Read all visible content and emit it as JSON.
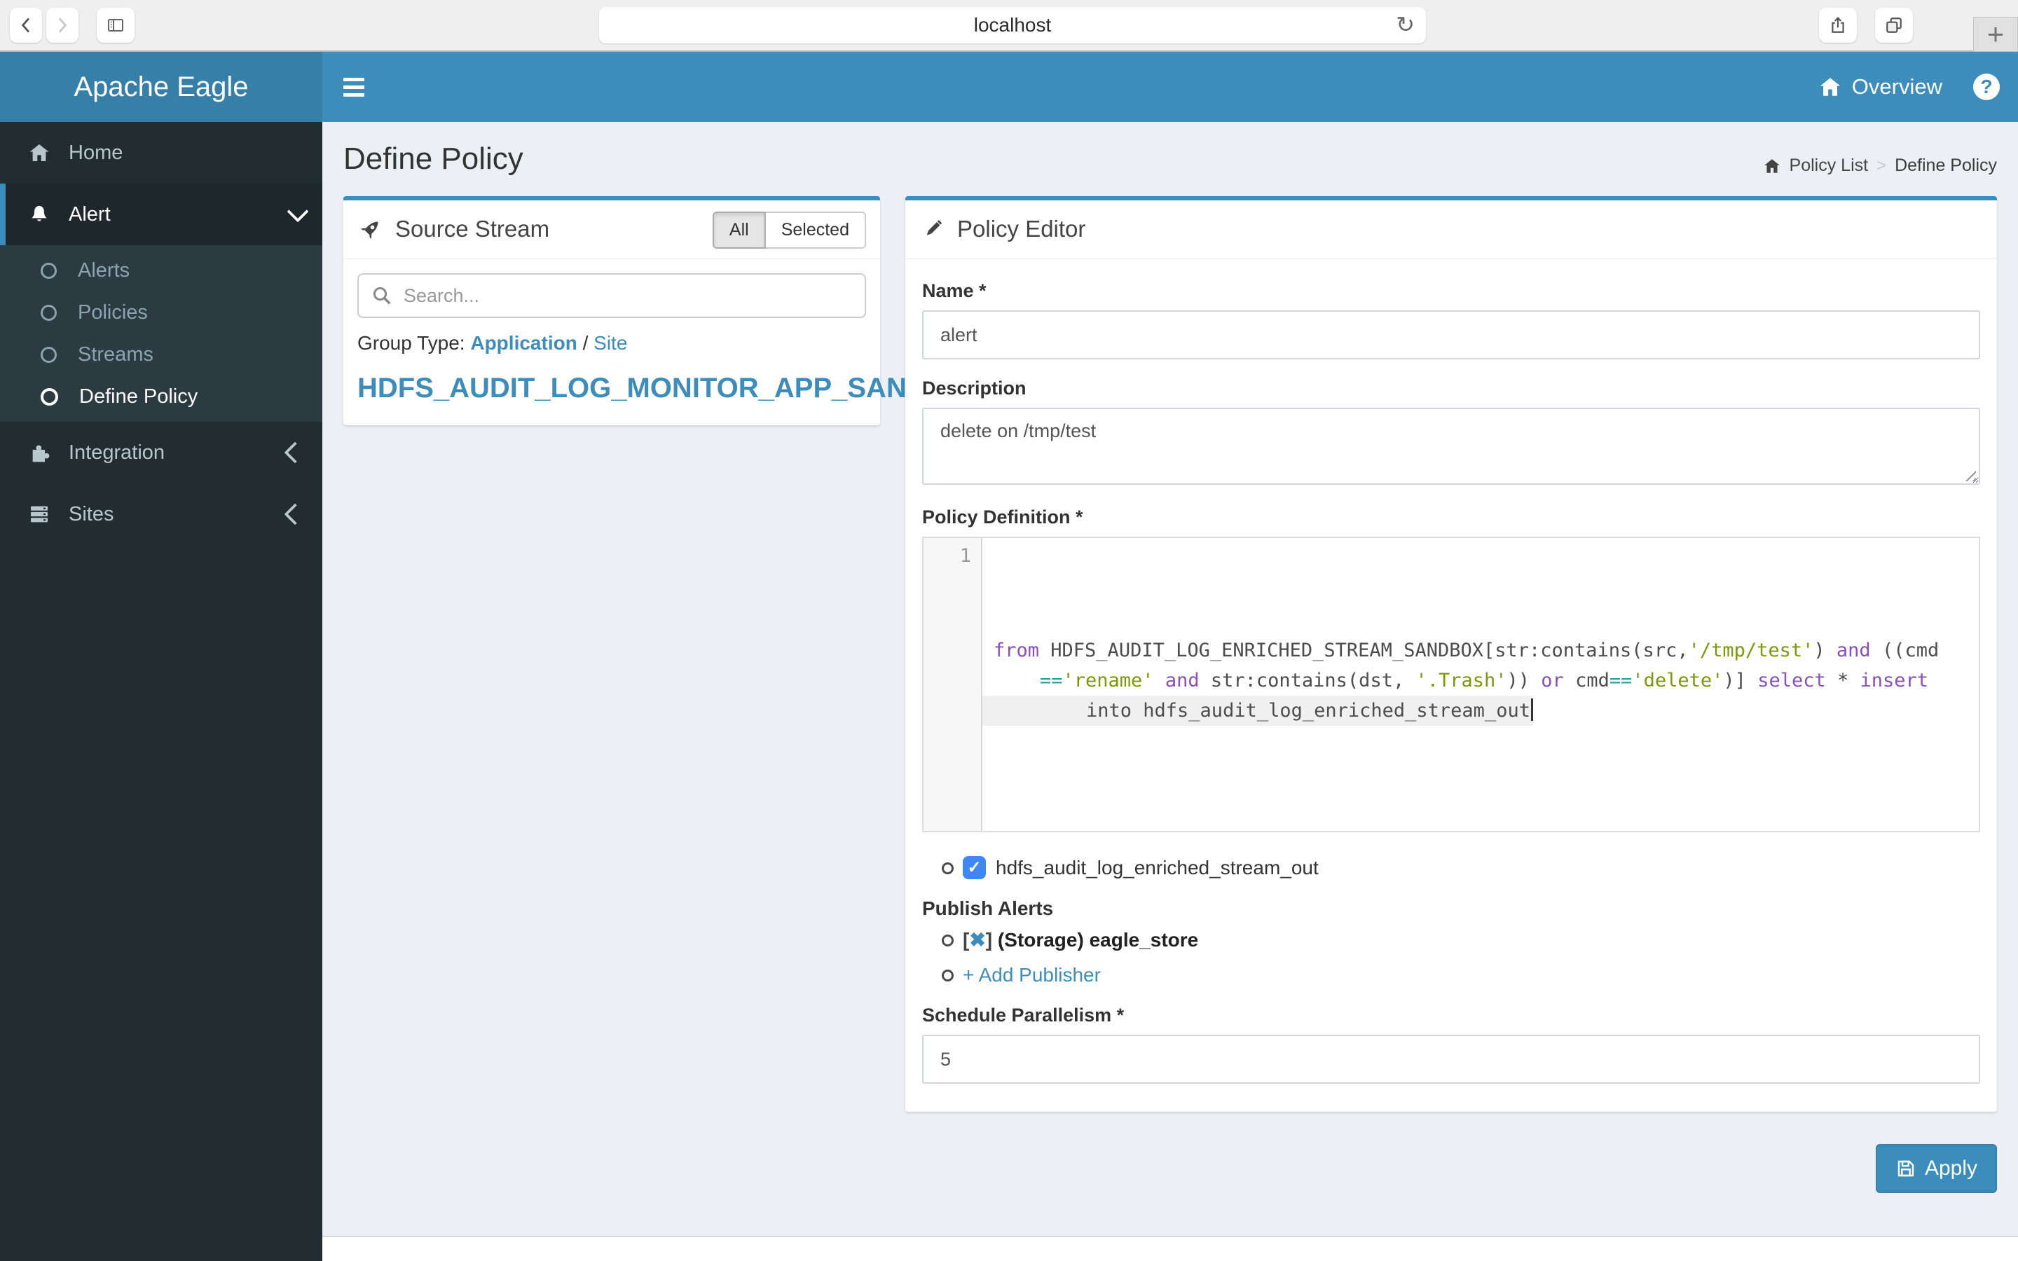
{
  "browser": {
    "url": "localhost",
    "new_tab_glyph": "+",
    "reload_glyph": "↻"
  },
  "navbar": {
    "brand": "Apache Eagle",
    "overview_label": "Overview",
    "help_glyph": "?"
  },
  "sidebar": {
    "home": "Home",
    "alert": {
      "label": "Alert",
      "children": [
        "Alerts",
        "Policies",
        "Streams",
        "Define Policy"
      ]
    },
    "integration": "Integration",
    "sites": "Sites"
  },
  "page": {
    "title": "Define Policy",
    "breadcrumb_parent": "Policy List",
    "breadcrumb_current": "Define Policy"
  },
  "source_stream": {
    "title": "Source Stream",
    "toggle_all": "All",
    "toggle_selected": "Selected",
    "search_placeholder": "Search...",
    "group_type_label": "Group Type:",
    "group_link_application": "Application",
    "group_link_site": "Site",
    "group_separator": "/",
    "stream_heading": "HDFS_AUDIT_LOG_MONITOR_APP_SANDBOX"
  },
  "policy_editor": {
    "title": "Policy Editor",
    "name_label": "Name *",
    "name_value": "alert",
    "description_label": "Description",
    "description_value": "delete on /tmp/test",
    "definition_label": "Policy Definition *",
    "code_line_number": "1",
    "code_lines": [
      {
        "indent": false,
        "highlight": false,
        "segments": [
          {
            "t": "from ",
            "c": "kw"
          },
          {
            "t": "HDFS_AUDIT_LOG_ENRICHED_STREAM_SANDBOX[str:contains(src,",
            "c": "pl"
          },
          {
            "t": "'/tmp/test'",
            "c": "str"
          },
          {
            "t": ") ",
            "c": "pl"
          },
          {
            "t": "and",
            "c": "kw"
          },
          {
            "t": " ((cmd",
            "c": "pl"
          }
        ]
      },
      {
        "indent": true,
        "highlight": false,
        "segments": [
          {
            "t": "==",
            "c": "op"
          },
          {
            "t": "'rename'",
            "c": "str"
          },
          {
            "t": " ",
            "c": "pl"
          },
          {
            "t": "and",
            "c": "kw"
          },
          {
            "t": " str:contains(dst, ",
            "c": "pl"
          },
          {
            "t": "'.Trash'",
            "c": "str"
          },
          {
            "t": ")) ",
            "c": "pl"
          },
          {
            "t": "or",
            "c": "kw"
          },
          {
            "t": " cmd",
            "c": "pl"
          },
          {
            "t": "==",
            "c": "op"
          },
          {
            "t": "'delete'",
            "c": "str"
          },
          {
            "t": ")] ",
            "c": "pl"
          },
          {
            "t": "select",
            "c": "kw"
          },
          {
            "t": " * ",
            "c": "pl"
          },
          {
            "t": "insert",
            "c": "kw"
          }
        ]
      },
      {
        "indent": true,
        "highlight": true,
        "segments": [
          {
            "t": "into hdfs_audit_log_enriched_stream_out",
            "c": "pl"
          }
        ]
      }
    ],
    "output_stream_checkbox": "hdfs_audit_log_enriched_stream_out",
    "checkbox_glyph": "✓",
    "publish_alerts_label": "Publish Alerts",
    "publisher_remove_glyph": "✖",
    "publisher_label": "(Storage) eagle_store",
    "add_publisher_label": "+ Add Publisher",
    "parallelism_label": "Schedule Parallelism *",
    "parallelism_value": "5",
    "apply_label": "Apply"
  },
  "colors": {
    "navbar": "#3c8dbc",
    "brand": "#367fa9",
    "sidebar": "#222d32",
    "submenu": "#2c3b41",
    "content_bg": "#ecf0f5",
    "link": "#3c8dbc",
    "code_keyword": "#8a4fc0",
    "code_string": "#7d9a00",
    "code_operator": "#2aa198",
    "checkbox_blue": "#3f87f5"
  }
}
